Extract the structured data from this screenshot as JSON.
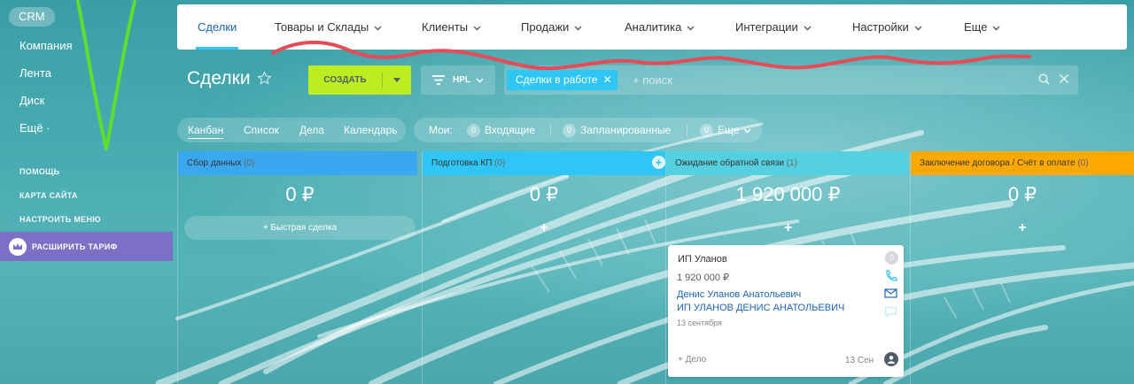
{
  "sidebar": {
    "crm": "CRM",
    "items": [
      "Компания",
      "Лента",
      "Диск",
      "Ещё ·"
    ],
    "secondary": [
      "ПОМОЩЬ",
      "КАРТА САЙТА",
      "НАСТРОИТЬ МЕНЮ"
    ],
    "upgrade": "РАСШИРИТЬ ТАРИФ"
  },
  "topnav": {
    "items": [
      "Сделки",
      "Товары и Склады",
      "Клиенты",
      "Продажи",
      "Аналитика",
      "Интеграции",
      "Настройки",
      "Еще"
    ],
    "active": "Сделки"
  },
  "toolbar": {
    "title": "Сделки",
    "create_label": "СОЗДАТЬ",
    "filter_label": "HPL",
    "filter_chip": "Сделки в работе",
    "search_placeholder": "+ поиск"
  },
  "views": {
    "items": [
      "Канбан",
      "Список",
      "Дела",
      "Календарь"
    ],
    "active": "Канбан"
  },
  "mine": {
    "label": "Мои:",
    "incoming_count": "0",
    "incoming": "Входящие",
    "planned_count": "0",
    "planned": "Запланированные",
    "more_count": "0",
    "more": "Еще"
  },
  "columns": [
    {
      "title": "Сбор данных",
      "count": "(0)",
      "sum": "0 ₽",
      "color": "#39a8ef"
    },
    {
      "title": "Подготовка КП",
      "count": "(0)",
      "sum": "0 ₽",
      "color": "#2fc6f6"
    },
    {
      "title": "Ожидание обратной связи",
      "count": "(1)",
      "sum": "1 920 000 ₽",
      "color": "#55d0e0"
    },
    {
      "title": "Заключение договора / Счёт в оплате",
      "count": "(0)",
      "sum": "0 ₽",
      "color": "#ffa900"
    }
  ],
  "quick_deal": "+ Быстрая сделка",
  "card": {
    "title": "ИП Уланов",
    "badge": "0",
    "price": "1 920 000 ₽",
    "contact": "Денис Уланов Анатольевич",
    "company": "ИП УЛАНОВ ДЕНИС АНАТОЛЬЕВИЧ",
    "date": "13 сентября",
    "action": "+ Дело",
    "when": "13 Сен"
  },
  "colors": {
    "accent": "#2fc6f6",
    "create_button": "#bbed21",
    "upgrade": "#7b6fc6",
    "annotation_green": "#5ede2e",
    "annotation_red": "#e84a56"
  }
}
